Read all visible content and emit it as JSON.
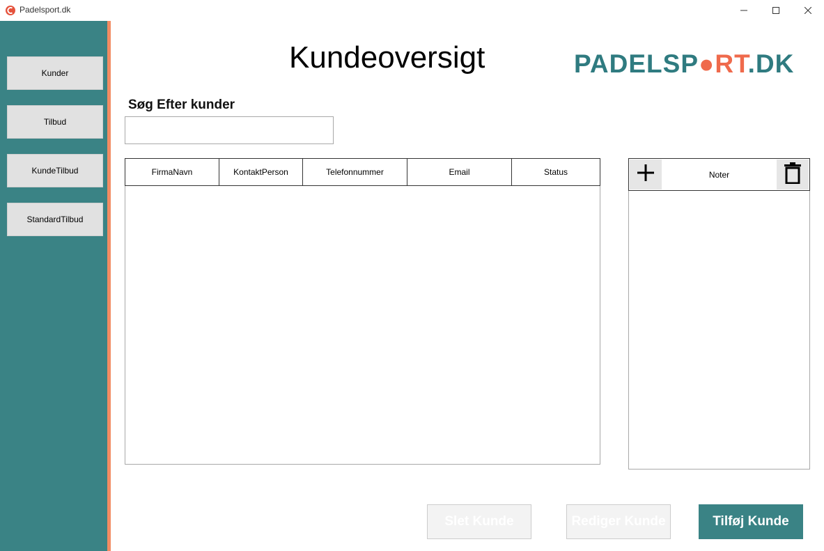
{
  "window": {
    "title": "Padelsport.dk",
    "controls": [
      "minimize-icon",
      "maximize-icon",
      "close-icon"
    ]
  },
  "sidebar": {
    "items": [
      {
        "label": "Kunder"
      },
      {
        "label": "Tilbud"
      },
      {
        "label": "KundeTilbud"
      },
      {
        "label": "StandardTilbud"
      }
    ]
  },
  "header": {
    "title": "Kundeoversigt",
    "logo": {
      "part1": "PADELSP",
      "part2": "RT",
      "part3": ".DK"
    }
  },
  "search": {
    "label": "Søg Efter kunder",
    "value": "",
    "placeholder": ""
  },
  "customers_table": {
    "columns": [
      "FirmaNavn",
      "KontaktPerson",
      "Telefonnummer",
      "Email",
      "Status"
    ],
    "rows": []
  },
  "notes": {
    "title": "Noter",
    "items": []
  },
  "actions": {
    "delete_label": "Slet Kunde",
    "edit_label": "Rediger Kunde",
    "add_label": "Tilføj Kunde"
  },
  "colors": {
    "sidebar": "#3a8385",
    "accent": "#f28c63",
    "primary_button": "#3a8385",
    "logo_teal": "#2f7b80",
    "logo_coral": "#ef6a4c"
  }
}
